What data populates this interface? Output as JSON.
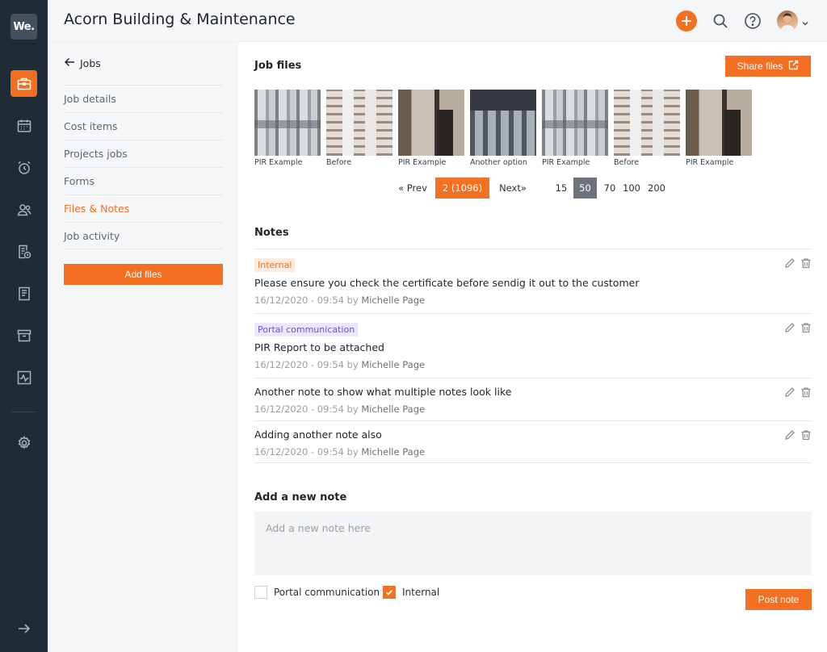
{
  "app": {
    "logo_text": "We.",
    "title": "Acorn Building & Maintenance",
    "accent": "#f36f21",
    "rail_bg": "#1f2b36"
  },
  "rail": {
    "icons": [
      "briefcase-icon",
      "calendar-icon",
      "alarm-clock-icon",
      "contacts-icon",
      "document-clock-icon",
      "invoice-icon",
      "archive-icon",
      "activity-chart-icon",
      "gear-icon",
      "arrow-right-icon"
    ],
    "active": "briefcase-icon"
  },
  "header": {
    "icons": [
      "plus-icon",
      "search-icon",
      "help-icon",
      "avatar",
      "chevron-down-icon"
    ]
  },
  "subnav": {
    "back_label": "Jobs",
    "items": [
      {
        "label": "Job details"
      },
      {
        "label": "Cost items"
      },
      {
        "label": "Projects jobs"
      },
      {
        "label": "Forms"
      },
      {
        "label": "Files & Notes",
        "active": true
      },
      {
        "label": "Job activity"
      }
    ],
    "add_files_label": "Add files"
  },
  "files": {
    "title": "Job files",
    "share_label": "Share files",
    "thumbnails": [
      {
        "caption": "PIR Example"
      },
      {
        "caption": "Before"
      },
      {
        "caption": "PIR Example"
      },
      {
        "caption": "Another option"
      },
      {
        "caption": "PIR Example"
      },
      {
        "caption": "Before"
      },
      {
        "caption": "PIR Example"
      }
    ],
    "pager": {
      "prev": "« Prev",
      "current": "2 (1096)",
      "next": "Next»",
      "sizes": [
        "15",
        "50",
        "70",
        "100",
        "200"
      ],
      "active_size": "50"
    }
  },
  "notes": {
    "title": "Notes",
    "items": [
      {
        "tag": "Internal",
        "tag_type": "internal",
        "text": "Please ensure you check the certificate before sendig it out to the customer",
        "date": "16/12/2020 - 09:54",
        "by_label": "by",
        "author": "Michelle Page"
      },
      {
        "tag": "Portal communication",
        "tag_type": "portal",
        "text": "PIR Report to be attached",
        "date": "16/12/2020 - 09:54",
        "by_label": "by",
        "author": "Michelle Page"
      },
      {
        "tag": "",
        "tag_type": "",
        "text": "Another note to show what multiple notes look like",
        "date": "16/12/2020 - 09:54",
        "by_label": "by",
        "author": "Michelle Page"
      },
      {
        "tag": "",
        "tag_type": "",
        "text": "Adding another note also",
        "date": "16/12/2020 - 09:54",
        "by_label": "by",
        "author": "Michelle Page"
      }
    ]
  },
  "new_note": {
    "title": "Add a new note",
    "placeholder": "Add a new note here",
    "value": "",
    "checkboxes": [
      {
        "label": "Portal communication",
        "checked": false
      },
      {
        "label": "Internal",
        "checked": true
      }
    ],
    "post_label": "Post note"
  }
}
